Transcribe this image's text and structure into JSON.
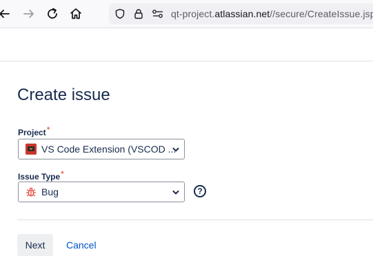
{
  "browser": {
    "url_prefix": "qt-project.",
    "url_host": "atlassian.net",
    "url_path": "//secure/CreateIssue.jspa",
    "icons": [
      "back-arrow-icon",
      "forward-arrow-icon",
      "reload-icon",
      "home-icon",
      "shield-icon",
      "lock-icon",
      "site-permissions-icon"
    ]
  },
  "form": {
    "title": "Create issue",
    "project": {
      "label": "Project",
      "required_mark": "*",
      "value": "VS Code Extension (VSCOD ...",
      "icon": "project-avatar-icon"
    },
    "issue_type": {
      "label": "Issue Type",
      "required_mark": "*",
      "value": "Bug",
      "icon": "bug-icon"
    },
    "help_symbol": "?",
    "next_label": "Next",
    "cancel_label": "Cancel"
  },
  "colors": {
    "accent": "#0052cc",
    "required": "#de350b",
    "bug": "#e5493a",
    "project_avatar": "#c9372c"
  }
}
